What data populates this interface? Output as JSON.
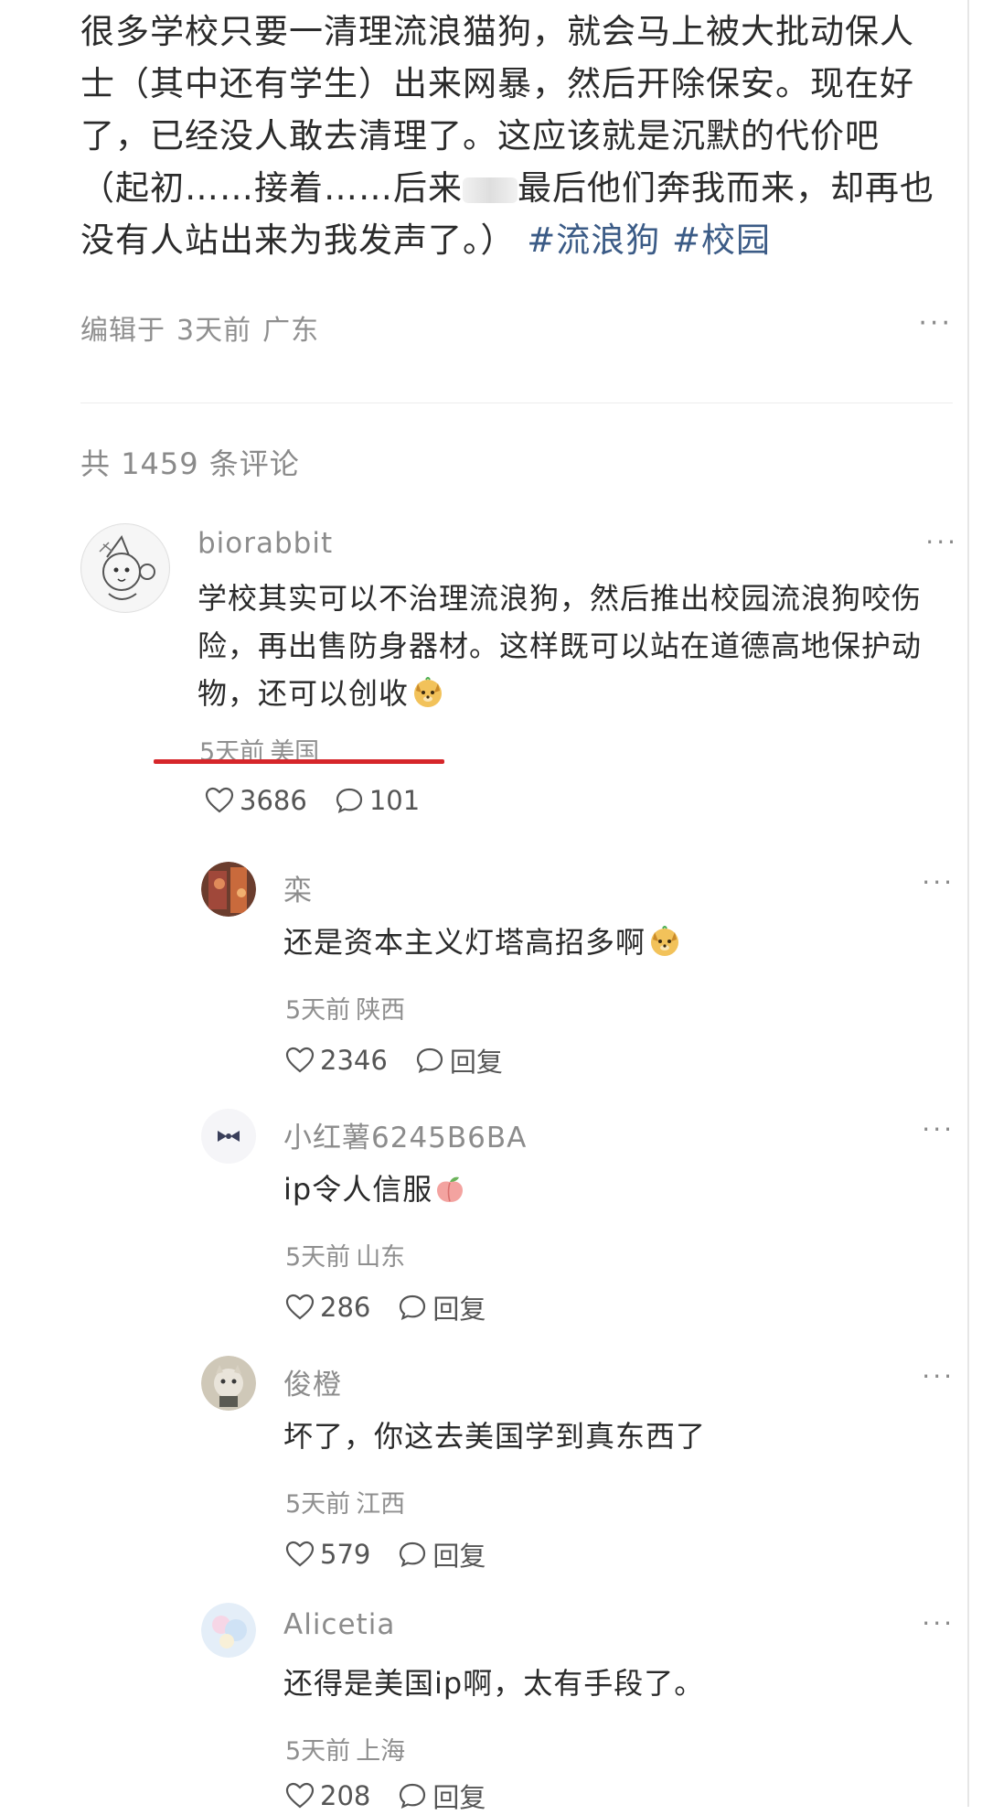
{
  "post": {
    "text_lines": [
      "很多学校只要一清理流浪猫狗，就会马上被大批动保人",
      "士（其中还有学生）出来网暴，然后开除保安。现在好",
      "了，已经没人敢去清理了。这应该就是沉默的代价吧",
      "（起初……接着……后来",
      "最后他们奔我而来，却再也",
      "没有人站出来为我发声了。）"
    ],
    "hashtags": [
      "#流浪狗",
      "#校园"
    ],
    "edited_label": "编辑于",
    "time": "3天前",
    "location": "广东",
    "more": "···"
  },
  "comments_header": {
    "prefix": "共",
    "count": "1459",
    "suffix": "条评论"
  },
  "comments": [
    {
      "username": "biorabbit",
      "text": "学校其实可以不治理流浪狗，然后推出校园流浪狗咬伤险，再出售防身器材。这样既可以站在道德高地保护动物，还可以创收",
      "time": "5天前",
      "location": "美国",
      "likes": "3686",
      "replies": "101",
      "more": "···"
    }
  ],
  "replies": [
    {
      "username": "栾",
      "text": "还是资本主义灯塔高招多啊",
      "time": "5天前",
      "location": "陕西",
      "likes": "2346",
      "reply_label": "回复",
      "more": "···"
    },
    {
      "username": "小红薯6245B6BA",
      "text": "ip令人信服",
      "time": "5天前",
      "location": "山东",
      "likes": "286",
      "reply_label": "回复",
      "more": "···"
    },
    {
      "username": "俊橙",
      "text": "坏了，你这去美国学到真东西了",
      "time": "5天前",
      "location": "江西",
      "likes": "579",
      "reply_label": "回复",
      "more": "···"
    },
    {
      "username": "Alicetia",
      "text": "还得是美国ip啊，太有手段了。",
      "time": "5天前",
      "location": "上海",
      "likes": "208",
      "reply_label": "回复",
      "more": "···"
    }
  ],
  "colors": {
    "hashtag": "#3b5b86",
    "meta_gray": "#8f8f8f",
    "highlight_underline": "#d6262a"
  },
  "icons": {
    "like": "heart-outline-icon",
    "reply": "speech-bubble-icon",
    "more": "ellipsis-icon",
    "emoji": "smiling-dog-emoji"
  }
}
